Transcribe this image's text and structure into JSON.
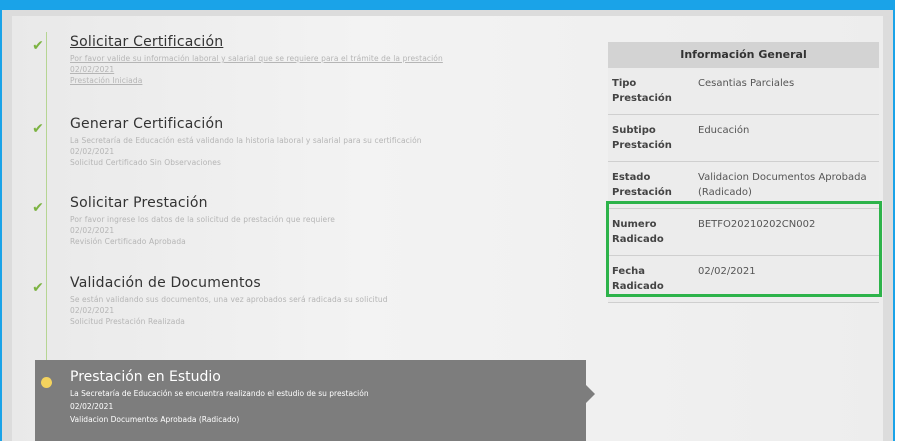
{
  "steps": [
    {
      "title": "Solicitar Certificación",
      "desc": "Por favor valide su información laboral y salarial que se requiere para el trámite de la prestación",
      "date": "02/02/2021",
      "status": "Prestación Iniciada"
    },
    {
      "title": "Generar Certificación",
      "desc": "La Secretaría de Educación está validando la historia laboral y salarial para su certificación",
      "date": "02/02/2021",
      "status": "Solicitud Certificado Sin Observaciones"
    },
    {
      "title": "Solicitar Prestación",
      "desc": "Por favor ingrese los datos de la solicitud de prestación que requiere",
      "date": "02/02/2021",
      "status": "Revisión Certificado Aprobada"
    },
    {
      "title": "Validación de Documentos",
      "desc": "Se están validando sus documentos, una vez aprobados será radicada su solicitud",
      "date": "02/02/2021",
      "status": "Solicitud Prestación Realizada"
    },
    {
      "title": "Prestación en Estudio",
      "desc": "La Secretaría de Educación se encuentra realizando el estudio de su prestación",
      "date": "02/02/2021",
      "status": "Validacion Documentos Aprobada (Radicado)"
    }
  ],
  "panel": {
    "title": "Información General",
    "rows": [
      {
        "label": "Tipo Prestación",
        "value": "Cesantias Parciales"
      },
      {
        "label": "Subtipo Prestación",
        "value": "Educación"
      },
      {
        "label": "Estado Prestación",
        "value": "Validacion Documentos Aprobada (Radicado)"
      },
      {
        "label": "Numero Radicado",
        "value": "BETFO20210202CN002"
      },
      {
        "label": "Fecha Radicado",
        "value": "02/02/2021"
      }
    ]
  },
  "colors": {
    "accent": "#1aa3e8",
    "check": "#7cb342",
    "active_bg": "#7d7d7d",
    "highlight": "#2db34a",
    "active_dot": "#f4d35e"
  }
}
